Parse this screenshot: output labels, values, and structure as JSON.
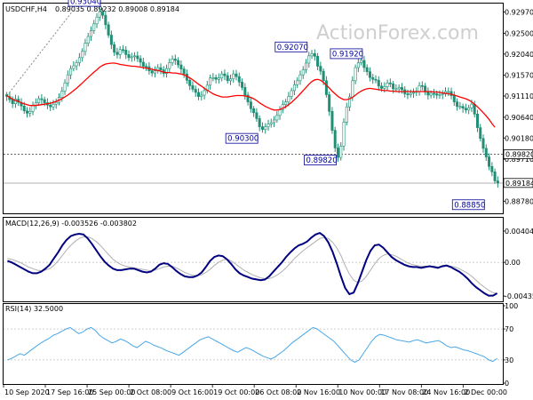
{
  "header": {
    "symbol": "USDCHF,H4",
    "ohlc": "0.89035 0.89232 0.89008 0.89184"
  },
  "watermark": "ActionForex.com",
  "colors": {
    "candles": "#208f75",
    "ma": "#ff0000",
    "macd": "#000080",
    "signal": "#b0b0b0",
    "rsi": "#4aa8e8",
    "label_border": "#000099",
    "level_line": "#808080"
  },
  "chart_data": [
    {
      "type": "candlestick",
      "title": "USDCHF,H4",
      "ylim": [
        0.8855,
        0.9312
      ],
      "y_ticks": [
        "0.92970",
        "0.92500",
        "0.92040",
        "0.91570",
        "0.91110",
        "0.90640",
        "0.90180",
        "0.89710",
        "0.88780"
      ],
      "x_ticks": [
        "10 Sep 2020",
        "17 Sep 16:00",
        "25 Sep 00:00",
        "2 Oct 08:00",
        "9 Oct 16:00",
        "19 Oct 00:00",
        "26 Oct 08:00",
        "2 Nov 16:00",
        "10 Nov 00:00",
        "17 Nov 08:00",
        "24 Nov 16:00",
        "2 Dec 00:00"
      ],
      "close": [
        0.911,
        0.9103,
        0.9094,
        0.9104,
        0.9097,
        0.9089,
        0.9078,
        0.9073,
        0.9077,
        0.9091,
        0.9096,
        0.9105,
        0.9103,
        0.9096,
        0.9091,
        0.9087,
        0.9093,
        0.9097,
        0.9108,
        0.9122,
        0.914,
        0.9158,
        0.9172,
        0.9178,
        0.9185,
        0.9196,
        0.921,
        0.9228,
        0.9243,
        0.9256,
        0.9271,
        0.9286,
        0.9298,
        0.929,
        0.9269,
        0.9246,
        0.9225,
        0.9208,
        0.9203,
        0.9214,
        0.9213,
        0.9203,
        0.9196,
        0.9198,
        0.92,
        0.9194,
        0.9186,
        0.9177,
        0.9176,
        0.9167,
        0.9162,
        0.9167,
        0.9174,
        0.9169,
        0.9161,
        0.9172,
        0.9185,
        0.9193,
        0.919,
        0.918,
        0.9171,
        0.916,
        0.9146,
        0.9134,
        0.9126,
        0.9119,
        0.911,
        0.9113,
        0.9123,
        0.9135,
        0.9151,
        0.9152,
        0.9148,
        0.9151,
        0.916,
        0.9156,
        0.9145,
        0.9149,
        0.916,
        0.9154,
        0.9142,
        0.913,
        0.9113,
        0.9098,
        0.9083,
        0.9074,
        0.9061,
        0.9043,
        0.9037,
        0.9043,
        0.9049,
        0.9052,
        0.9058,
        0.9068,
        0.9081,
        0.9092,
        0.9098,
        0.911,
        0.9123,
        0.9136,
        0.9145,
        0.9158,
        0.9169,
        0.9184,
        0.92,
        0.9205,
        0.9199,
        0.9177,
        0.9166,
        0.9145,
        0.9114,
        0.9077,
        0.9035,
        0.8996,
        0.8975,
        0.9,
        0.9053,
        0.9087,
        0.9109,
        0.9145,
        0.9174,
        0.9185,
        0.919,
        0.9174,
        0.9165,
        0.9152,
        0.9148,
        0.9146,
        0.9133,
        0.9128,
        0.9132,
        0.914,
        0.9138,
        0.9127,
        0.9127,
        0.913,
        0.9125,
        0.9116,
        0.9114,
        0.9117,
        0.9119,
        0.9121,
        0.9134,
        0.9133,
        0.912,
        0.9113,
        0.9117,
        0.9116,
        0.9113,
        0.9114,
        0.9116,
        0.9121,
        0.9121,
        0.9112,
        0.9098,
        0.9088,
        0.9088,
        0.9084,
        0.908,
        0.9085,
        0.9093,
        0.9071,
        0.9041,
        0.9017,
        0.8995,
        0.8976,
        0.8955,
        0.8943,
        0.8923,
        0.8918
      ],
      "ma": [
        0.9112,
        0.9108,
        0.9104,
        0.9101,
        0.9099,
        0.9096,
        0.9094,
        0.9092,
        0.909,
        0.909,
        0.909,
        0.9091,
        0.9092,
        0.9093,
        0.9094,
        0.9095,
        0.9097,
        0.9099,
        0.9102,
        0.9105,
        0.9109,
        0.9113,
        0.9118,
        0.9123,
        0.9128,
        0.9134,
        0.914,
        0.9146,
        0.9152,
        0.9158,
        0.9164,
        0.9169,
        0.9175,
        0.9179,
        0.9182,
        0.9183,
        0.9184,
        0.9184,
        0.9183,
        0.9181,
        0.918,
        0.9179,
        0.9178,
        0.9177,
        0.9177,
        0.9176,
        0.9175,
        0.9174,
        0.9173,
        0.9172,
        0.917,
        0.9169,
        0.9168,
        0.9166,
        0.9164,
        0.9163,
        0.9163,
        0.9162,
        0.9162,
        0.9161,
        0.916,
        0.9158,
        0.9155,
        0.9151,
        0.9147,
        0.9142,
        0.9137,
        0.9133,
        0.9128,
        0.9124,
        0.912,
        0.9116,
        0.9113,
        0.9111,
        0.9109,
        0.9109,
        0.9109,
        0.911,
        0.9111,
        0.9112,
        0.9112,
        0.9112,
        0.9111,
        0.911,
        0.9108,
        0.9105,
        0.9101,
        0.9096,
        0.9092,
        0.9088,
        0.9085,
        0.9082,
        0.908,
        0.908,
        0.9081,
        0.9084,
        0.9087,
        0.9092,
        0.9097,
        0.9103,
        0.9109,
        0.9116,
        0.9123,
        0.913,
        0.9137,
        0.9143,
        0.9147,
        0.9148,
        0.9146,
        0.9141,
        0.9135,
        0.9129,
        0.9122,
        0.9116,
        0.911,
        0.9106,
        0.9103,
        0.9103,
        0.9105,
        0.9108,
        0.9113,
        0.9118,
        0.9122,
        0.9125,
        0.9127,
        0.9128,
        0.9127,
        0.9126,
        0.9125,
        0.9124,
        0.9123,
        0.9123,
        0.9122,
        0.9122,
        0.9121,
        0.9121,
        0.9121,
        0.9121,
        0.9121,
        0.9121,
        0.9121,
        0.9121,
        0.9121,
        0.9121,
        0.9121,
        0.9121,
        0.9121,
        0.912,
        0.912,
        0.9119,
        0.9118,
        0.9117,
        0.9116,
        0.9115,
        0.9113,
        0.9111,
        0.9109,
        0.9107,
        0.9105,
        0.9102,
        0.9098,
        0.9093,
        0.9087,
        0.9081,
        0.9074,
        0.9067,
        0.9059,
        0.905,
        0.9042
      ],
      "level_lines": [
        0.8982,
        0.8918
      ],
      "price_badges": [
        "0.89820",
        "0.89184"
      ],
      "annotations": [
        {
          "label": "0.93040",
          "at": 31,
          "price": 0.9304
        },
        {
          "label": "0.90300",
          "at": 87,
          "price": 0.903
        },
        {
          "label": "0.92070",
          "at": 104,
          "price": 0.9207
        },
        {
          "label": "0.89820",
          "at": 114,
          "price": 0.8982
        },
        {
          "label": "0.91920",
          "at": 123,
          "price": 0.9192
        },
        {
          "label": "0.88850",
          "at": 165,
          "price": 0.8885
        }
      ]
    },
    {
      "type": "line",
      "title": "MACD(12,26,9) -0.003526 -0.003802",
      "ylim": [
        -0.0048,
        0.0045
      ],
      "y_ticks": [
        "0.004048",
        "0.00",
        "-0.004351"
      ],
      "series": [
        {
          "name": "MACD",
          "values": [
            0.0002,
            0.0,
            -0.0003,
            -0.0006,
            -0.0009,
            -0.0012,
            -0.0014,
            -0.0014,
            -0.0012,
            -0.0008,
            -0.0003,
            0.0005,
            0.0013,
            0.0022,
            0.0029,
            0.0034,
            0.0036,
            0.0037,
            0.0036,
            0.0031,
            0.0024,
            0.0016,
            0.0008,
            0.0001,
            -0.0004,
            -0.0008,
            -0.001,
            -0.001,
            -0.0009,
            -0.0008,
            -0.0008,
            -0.001,
            -0.0012,
            -0.0013,
            -0.0012,
            -0.0008,
            -0.0003,
            -0.0001,
            -0.0002,
            -0.0006,
            -0.0011,
            -0.0015,
            -0.0018,
            -0.0019,
            -0.0019,
            -0.0017,
            -0.0013,
            -0.0006,
            0.0002,
            0.0007,
            0.0009,
            0.0008,
            0.0004,
            -0.0002,
            -0.0009,
            -0.0014,
            -0.0017,
            -0.0019,
            -0.0021,
            -0.0022,
            -0.0023,
            -0.0022,
            -0.0018,
            -0.0012,
            -0.0006,
            0.0,
            0.0007,
            0.0013,
            0.0018,
            0.0022,
            0.0024,
            0.0027,
            0.0032,
            0.0036,
            0.0038,
            0.0034,
            0.0026,
            0.0014,
            -0.0001,
            -0.0018,
            -0.0033,
            -0.0041,
            -0.0039,
            -0.0027,
            -0.0012,
            0.0003,
            0.0015,
            0.0022,
            0.0023,
            0.0019,
            0.0013,
            0.0007,
            0.0003,
            0.0,
            -0.0003,
            -0.0005,
            -0.0006,
            -0.0006,
            -0.0007,
            -0.0006,
            -0.0005,
            -0.0006,
            -0.0007,
            -0.0005,
            -0.0004,
            -0.0006,
            -0.0009,
            -0.0012,
            -0.0016,
            -0.0021,
            -0.0027,
            -0.0032,
            -0.0036,
            -0.004,
            -0.0043,
            -0.0043,
            -0.004
          ]
        },
        {
          "name": "Signal",
          "values": [
            0.0005,
            0.0004,
            0.0002,
            0.0,
            -0.0003,
            -0.0006,
            -0.0008,
            -0.001,
            -0.0011,
            -0.001,
            -0.0008,
            -0.0004,
            0.0002,
            0.0009,
            0.0016,
            0.0022,
            0.0027,
            0.0031,
            0.0033,
            0.0033,
            0.0031,
            0.0027,
            0.0022,
            0.0016,
            0.001,
            0.0004,
            0.0,
            -0.0003,
            -0.0005,
            -0.0006,
            -0.0007,
            -0.0008,
            -0.0009,
            -0.001,
            -0.0011,
            -0.001,
            -0.0008,
            -0.0006,
            -0.0005,
            -0.0005,
            -0.0007,
            -0.001,
            -0.0013,
            -0.0015,
            -0.0017,
            -0.0017,
            -0.0016,
            -0.0013,
            -0.0009,
            -0.0004,
            0.0,
            0.0003,
            0.0004,
            0.0002,
            -0.0002,
            -0.0006,
            -0.001,
            -0.0013,
            -0.0016,
            -0.0018,
            -0.002,
            -0.0021,
            -0.0021,
            -0.0019,
            -0.0016,
            -0.0012,
            -0.0007,
            -0.0001,
            0.0005,
            0.001,
            0.0015,
            0.0019,
            0.0023,
            0.0027,
            0.0031,
            0.0032,
            0.0031,
            0.0026,
            0.0019,
            0.0009,
            -0.0004,
            -0.0015,
            -0.0023,
            -0.0026,
            -0.0024,
            -0.0018,
            -0.001,
            -0.0002,
            0.0005,
            0.0009,
            0.0011,
            0.001,
            0.0008,
            0.0005,
            0.0002,
            -0.0001,
            -0.0003,
            -0.0004,
            -0.0005,
            -0.0005,
            -0.0005,
            -0.0005,
            -0.0006,
            -0.0006,
            -0.0005,
            -0.0005,
            -0.0006,
            -0.0008,
            -0.0011,
            -0.0014,
            -0.0018,
            -0.0023,
            -0.0028,
            -0.0032,
            -0.0036,
            -0.0039,
            -0.004
          ]
        }
      ]
    },
    {
      "type": "line",
      "title": "RSI(14) 32.5000",
      "ylim": [
        0,
        100
      ],
      "y_ticks": [
        "100",
        "70",
        "30",
        "0"
      ],
      "levels": [
        70,
        30
      ],
      "series": [
        {
          "name": "RSI",
          "values": [
            30,
            32,
            35,
            38,
            36,
            40,
            44,
            48,
            52,
            55,
            58,
            62,
            64,
            67,
            70,
            72,
            68,
            64,
            66,
            70,
            72,
            68,
            62,
            58,
            55,
            52,
            54,
            57,
            55,
            52,
            48,
            46,
            50,
            54,
            52,
            49,
            47,
            45,
            42,
            40,
            38,
            36,
            40,
            44,
            48,
            52,
            56,
            58,
            60,
            57,
            54,
            51,
            48,
            45,
            42,
            40,
            43,
            46,
            44,
            41,
            38,
            35,
            33,
            31,
            34,
            38,
            42,
            47,
            52,
            56,
            60,
            64,
            68,
            72,
            70,
            66,
            62,
            58,
            54,
            48,
            42,
            36,
            30,
            27,
            30,
            38,
            46,
            54,
            60,
            63,
            62,
            60,
            58,
            56,
            55,
            54,
            53,
            55,
            56,
            54,
            52,
            53,
            54,
            55,
            52,
            48,
            46,
            47,
            45,
            43,
            42,
            40,
            38,
            36,
            34,
            30,
            28,
            32
          ]
        }
      ]
    }
  ]
}
